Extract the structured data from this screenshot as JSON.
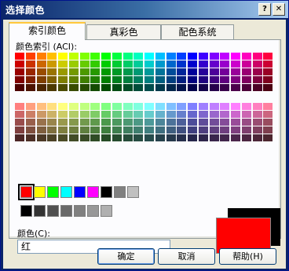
{
  "window": {
    "title": "选择颜色",
    "help_button": "?",
    "close_button": "✕"
  },
  "tabs": [
    {
      "label": "索引颜色",
      "active": true
    },
    {
      "label": "真彩色",
      "active": false
    },
    {
      "label": "配色系统",
      "active": false
    }
  ],
  "aci": {
    "label": "颜色索引 (ACI):",
    "top_rows": [
      [
        "#FF0000",
        "#FF3F00",
        "#FF7F00",
        "#FFBF00",
        "#FFFF00",
        "#BFFF00",
        "#7FFF00",
        "#3FFF00",
        "#00FF00",
        "#00FF3F",
        "#00FF7F",
        "#00FFBF",
        "#00FFFF",
        "#00BFFF",
        "#007FFF",
        "#003FFF",
        "#0000FF",
        "#3F00FF",
        "#7F00FF",
        "#BF00FF",
        "#FF00FF",
        "#FF00BF",
        "#FF007F",
        "#FF003F"
      ],
      [
        "#CC0000",
        "#CC3300",
        "#CC6600",
        "#CC9900",
        "#CCCC00",
        "#99CC00",
        "#66CC00",
        "#33CC00",
        "#00CC00",
        "#00CC33",
        "#00CC66",
        "#00CC99",
        "#00CCCC",
        "#0099CC",
        "#0066CC",
        "#0033CC",
        "#0000CC",
        "#3300CC",
        "#6600CC",
        "#9900CC",
        "#CC00CC",
        "#CC0099",
        "#CC0066",
        "#CC0033"
      ],
      [
        "#990000",
        "#992600",
        "#994C00",
        "#997300",
        "#999900",
        "#739900",
        "#4C9900",
        "#269900",
        "#009900",
        "#009926",
        "#00994C",
        "#009973",
        "#009999",
        "#007399",
        "#004C99",
        "#002699",
        "#000099",
        "#260099",
        "#4C0099",
        "#730099",
        "#990099",
        "#990073",
        "#99004C",
        "#990026"
      ],
      [
        "#7F0000",
        "#7F1F00",
        "#7F3F00",
        "#7F5F00",
        "#7F7F00",
        "#5F7F00",
        "#3F7F00",
        "#1F7F00",
        "#007F00",
        "#007F1F",
        "#007F3F",
        "#007F5F",
        "#007F7F",
        "#005F7F",
        "#003F7F",
        "#001F7F",
        "#00007F",
        "#1F007F",
        "#3F007F",
        "#5F007F",
        "#7F007F",
        "#7F005F",
        "#7F003F",
        "#7F001F"
      ],
      [
        "#4C0000",
        "#4C1300",
        "#4C2600",
        "#4C3900",
        "#4C4C00",
        "#394C00",
        "#264C00",
        "#134C00",
        "#004C00",
        "#004C13",
        "#004C26",
        "#004C39",
        "#004C4C",
        "#00394C",
        "#00264C",
        "#00134C",
        "#00004C",
        "#13004C",
        "#26004C",
        "#39004C",
        "#4C004C",
        "#4C0039",
        "#4C0026",
        "#4C0013"
      ]
    ],
    "bottom_rows": [
      [
        "#FF7F7F",
        "#FF9F7F",
        "#FFBF7F",
        "#FFDF7F",
        "#FFFF7F",
        "#DFFF7F",
        "#BFFF7F",
        "#9FFF7F",
        "#7FFF7F",
        "#7FFF9F",
        "#7FFFBF",
        "#7FFFDF",
        "#7FFFFF",
        "#7FDFFF",
        "#7FBFFF",
        "#7F9FFF",
        "#7F7FFF",
        "#9F7FFF",
        "#BF7FFF",
        "#DF7FFF",
        "#FF7FFF",
        "#FF7FDF",
        "#FF7FBF",
        "#FF7F9F"
      ],
      [
        "#CC6666",
        "#CC7F66",
        "#CC9966",
        "#CCB266",
        "#CCCC66",
        "#B2CC66",
        "#99CC66",
        "#7FCC66",
        "#66CC66",
        "#66CC7F",
        "#66CC99",
        "#66CCB2",
        "#66CCCC",
        "#66B2CC",
        "#6699CC",
        "#667FCC",
        "#6666CC",
        "#7F66CC",
        "#9966CC",
        "#B266CC",
        "#CC66CC",
        "#CC66B2",
        "#CC6699",
        "#CC667F"
      ],
      [
        "#994C4C",
        "#995F4C",
        "#99724C",
        "#99854C",
        "#99994C",
        "#85994C",
        "#72994C",
        "#5F994C",
        "#4C994C",
        "#4C995F",
        "#4C9972",
        "#4C9985",
        "#4C9999",
        "#4C8599",
        "#4C7299",
        "#4C5F99",
        "#4C4C99",
        "#5F4C99",
        "#724C99",
        "#854C99",
        "#994C99",
        "#994C85",
        "#994C72",
        "#994C5F"
      ],
      [
        "#7F3F3F",
        "#7F4F3F",
        "#7F5F3F",
        "#7F6F3F",
        "#7F7F3F",
        "#6F7F3F",
        "#5F7F3F",
        "#4F7F3F",
        "#3F7F3F",
        "#3F7F4F",
        "#3F7F5F",
        "#3F7F6F",
        "#3F7F7F",
        "#3F6F7F",
        "#3F5F7F",
        "#3F4F7F",
        "#3F3F7F",
        "#4F3F7F",
        "#5F3F7F",
        "#6F3F7F",
        "#7F3F7F",
        "#7F3F6F",
        "#7F3F5F",
        "#7F3F4F"
      ],
      [
        "#4C2626",
        "#4C2F26",
        "#4C3926",
        "#4C4226",
        "#4C4C26",
        "#424C26",
        "#394C26",
        "#2F4C26",
        "#264C26",
        "#264C2F",
        "#264C39",
        "#264C42",
        "#264C4C",
        "#26424C",
        "#26394C",
        "#262F4C",
        "#26264C",
        "#2F264C",
        "#39264C",
        "#42264C",
        "#4C264C",
        "#4C2642",
        "#4C2639",
        "#4C262F"
      ]
    ]
  },
  "standard_colors": [
    "#FF0000",
    "#FFFF00",
    "#00FF00",
    "#00FFFF",
    "#0000FF",
    "#FF00FF",
    "#000000",
    "#808080",
    "#C0C0C0"
  ],
  "gray_colors": [
    "#000000",
    "#333333",
    "#505050",
    "#696969",
    "#808080",
    "#989898",
    "#B0B0B0"
  ],
  "selected_standard_index": 0,
  "color_label": "颜色(C):",
  "color_value": "红",
  "preview": {
    "old_color": "#000000",
    "new_color": "#FF0000"
  },
  "buttons": {
    "ok": "确定",
    "cancel": "取消",
    "help": "帮助(H)"
  }
}
